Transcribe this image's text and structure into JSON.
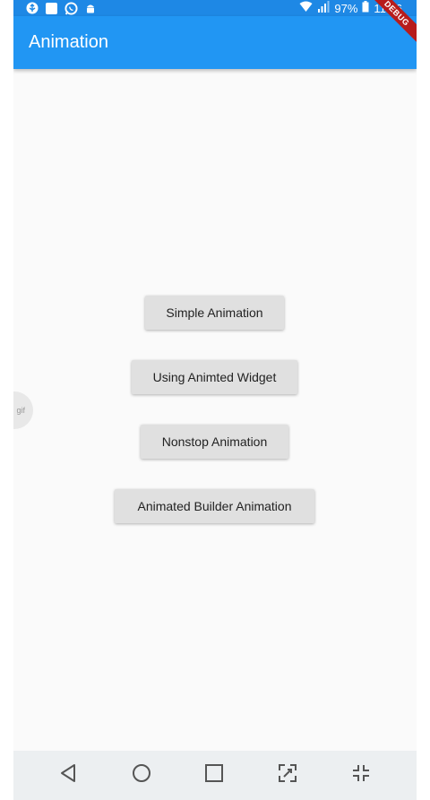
{
  "status_bar": {
    "battery": "97%",
    "time": "11:06",
    "icons": [
      "usb-icon",
      "notification-square-icon",
      "whatsapp-icon",
      "android-icon",
      "wifi-icon",
      "signal-icon",
      "battery-icon"
    ]
  },
  "app_bar": {
    "title": "Animation",
    "debug_banner": "DEBUG",
    "color": "#2196f3"
  },
  "buttons": [
    {
      "label": "Simple Animation"
    },
    {
      "label": "Using Animted Widget"
    },
    {
      "label": "Nonstop Animation"
    },
    {
      "label": "Animated Builder Animation"
    }
  ],
  "overlay": {
    "gif_label": "gif"
  },
  "nav_bar": {
    "icons": [
      "back-icon",
      "home-icon",
      "recents-icon",
      "expand-icon",
      "collapse-icon"
    ]
  }
}
